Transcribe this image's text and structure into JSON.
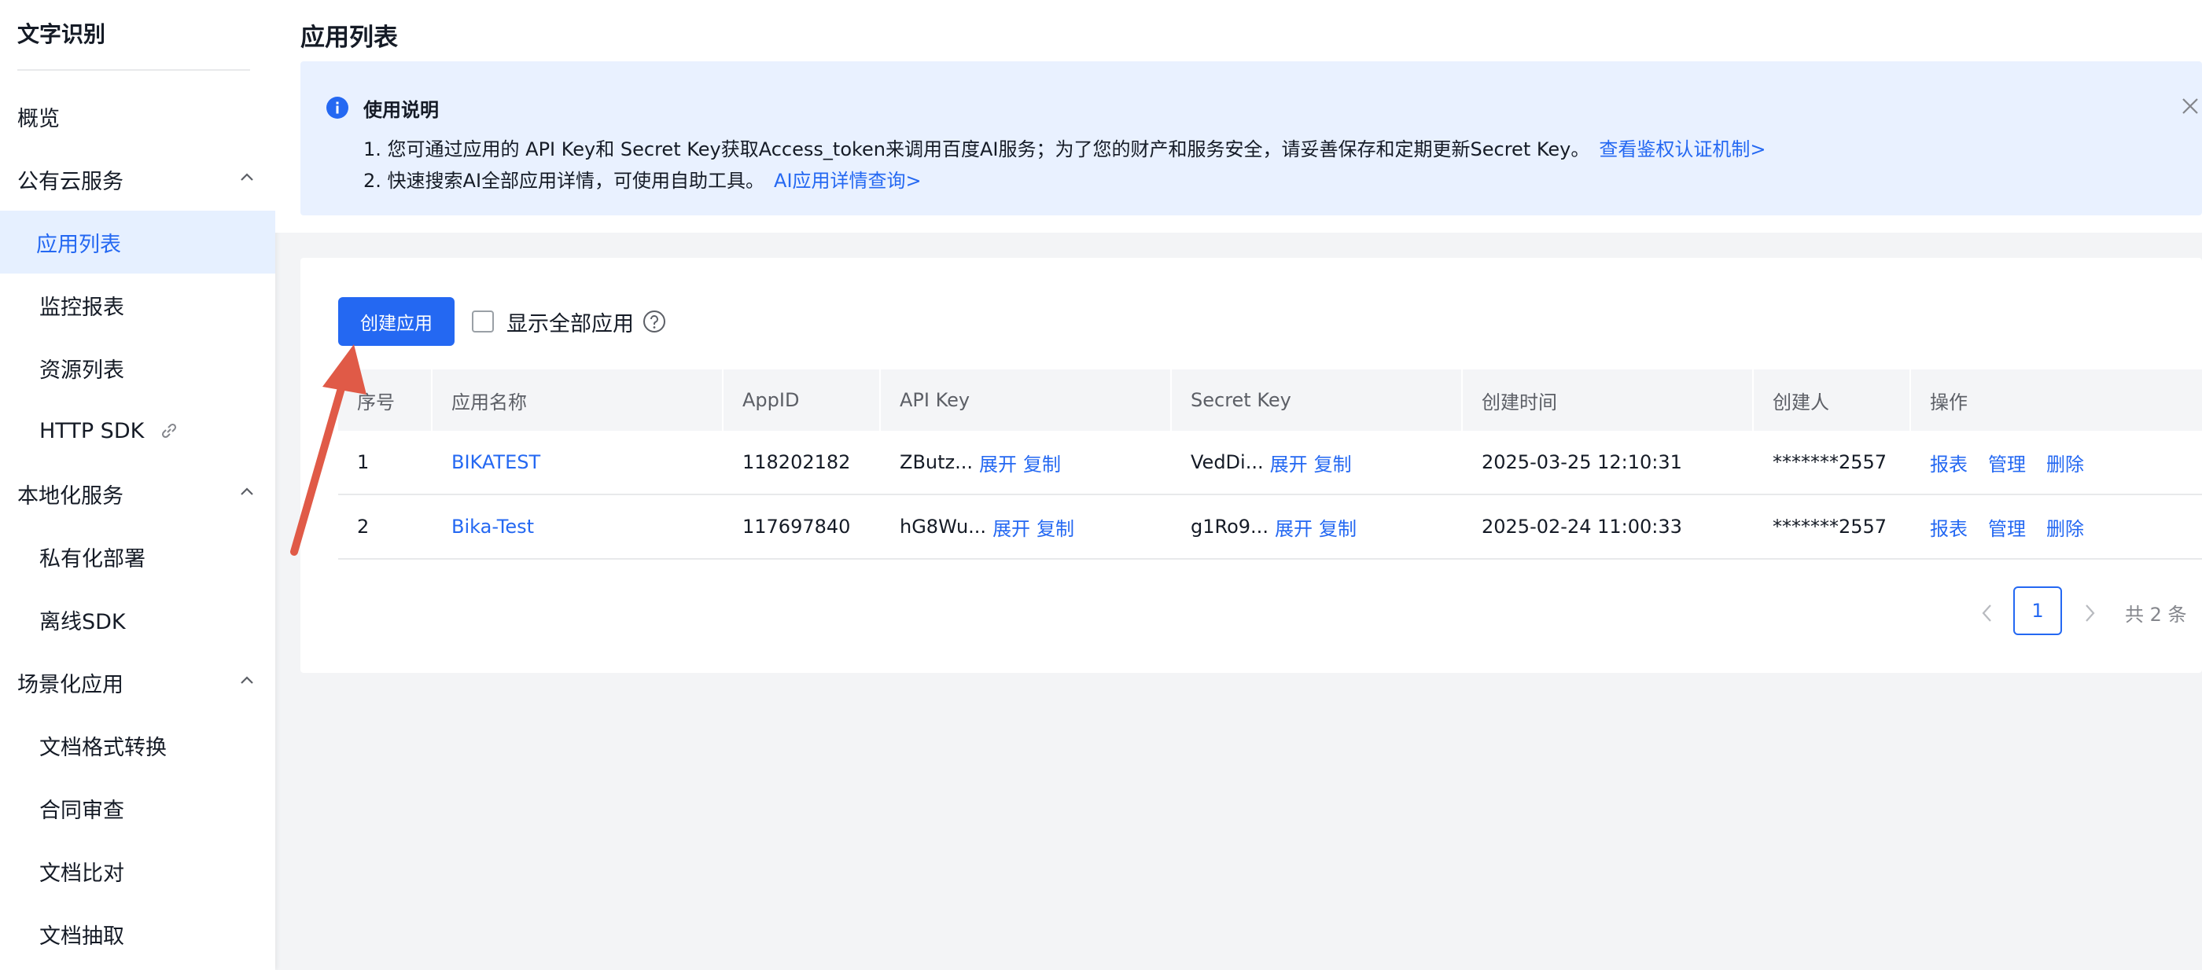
{
  "sidebar": {
    "title": "文字识别",
    "items": [
      {
        "label": "概览"
      },
      {
        "label": "公有云服务"
      },
      {
        "label": "应用列表"
      },
      {
        "label": "监控报表"
      },
      {
        "label": "资源列表"
      },
      {
        "label": "HTTP SDK"
      },
      {
        "label": "本地化服务"
      },
      {
        "label": "私有化部署"
      },
      {
        "label": "离线SDK"
      },
      {
        "label": "场景化应用"
      },
      {
        "label": "文档格式转换"
      },
      {
        "label": "合同审查"
      },
      {
        "label": "文档比对"
      },
      {
        "label": "文档抽取"
      }
    ]
  },
  "header": {
    "title": "应用列表"
  },
  "notice": {
    "title": "使用说明",
    "line1": "1. 您可通过应用的 API Key和 Secret Key获取Access_token来调用百度AI服务；为了您的财产和服务安全，请妥善保存和定期更新Secret Key。",
    "line1_link": "查看鉴权认证机制>",
    "line2": "2. 快速搜索AI全部应用详情，可使用自助工具。",
    "line2_link": "AI应用详情查询>"
  },
  "toolbar": {
    "create_label": "创建应用",
    "show_all_label": "显示全部应用"
  },
  "table": {
    "columns": [
      "序号",
      "应用名称",
      "AppID",
      "API Key",
      "Secret Key",
      "创建时间",
      "创建人",
      "操作"
    ],
    "rows": [
      {
        "index": "1",
        "name": "BIKATEST",
        "appid": "118202182",
        "api_key": "ZButz...",
        "secret_key": "VedDi...",
        "created": "2025-03-25 12:10:31",
        "creator": "*******2557"
      },
      {
        "index": "2",
        "name": "Bika-Test",
        "appid": "117697840",
        "api_key": "hG8Wu...",
        "secret_key": "g1Ro9...",
        "created": "2025-02-24 11:00:33",
        "creator": "*******2557"
      }
    ],
    "expand_label": "展开",
    "copy_label": "复制",
    "ops": [
      "报表",
      "管理",
      "删除"
    ]
  },
  "pagination": {
    "current": "1",
    "total_text": "共 2 条"
  },
  "colors": {
    "accent": "#2468f2",
    "annotation_arrow": "#e05a47"
  }
}
